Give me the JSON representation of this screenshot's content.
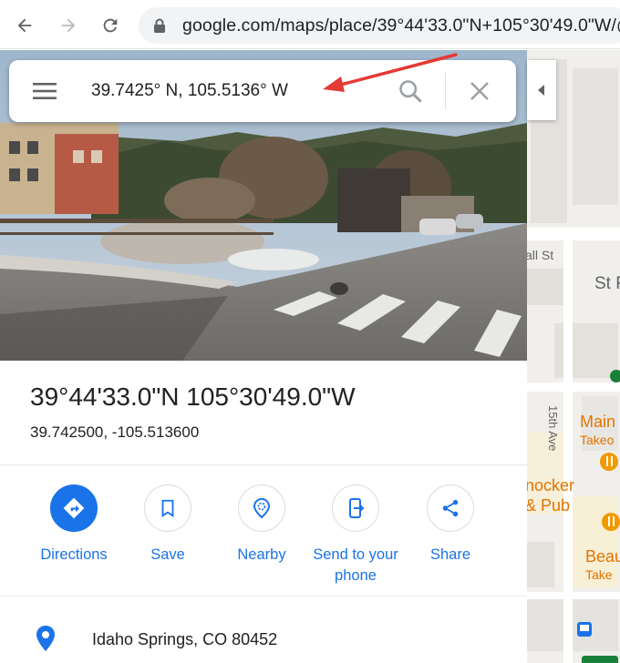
{
  "browser": {
    "url": "google.com/maps/place/39°44'33.0\"N+105°30'49.0\"W/@"
  },
  "search": {
    "value": "39.7425° N, 105.5136° W"
  },
  "place": {
    "title": "39°44'33.0\"N 105°30'49.0\"W",
    "decimal_coords": "39.742500, -105.513600",
    "address": "Idaho Springs, CO 80452"
  },
  "actions": [
    {
      "label": "Directions",
      "icon": "directions-icon"
    },
    {
      "label": "Save",
      "icon": "bookmark-icon"
    },
    {
      "label": "Nearby",
      "icon": "nearby-icon"
    },
    {
      "label": "Send to your phone",
      "icon": "send-to-phone-icon"
    },
    {
      "label": "Share",
      "icon": "share-icon"
    }
  ],
  "map": {
    "labels": [
      "all St",
      "St F",
      "15th Ave",
      "Main",
      "Takeo",
      "nocker",
      "& Pub",
      "Beau",
      "Take"
    ]
  },
  "colors": {
    "accent": "#1a73e8",
    "annotation_arrow": "#e53935",
    "poi_orange": "#f29900"
  }
}
